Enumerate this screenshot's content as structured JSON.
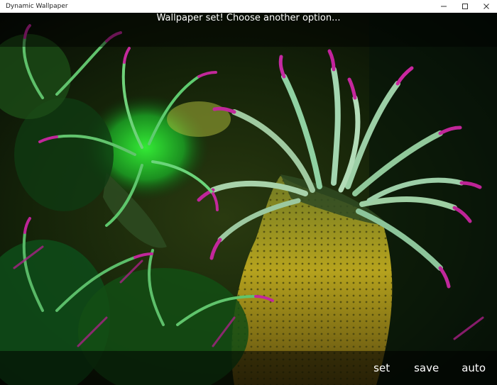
{
  "window": {
    "title": "Dynamic Wallpaper",
    "controls": [
      "minimize-icon",
      "maximize-icon",
      "close-icon"
    ]
  },
  "status": {
    "message": "Wallpaper set! Choose another option..."
  },
  "actions": {
    "set_label": "set",
    "save_label": "save",
    "auto_label": "auto"
  },
  "colors": {
    "overlay": "#000000",
    "text": "#ffffff"
  }
}
